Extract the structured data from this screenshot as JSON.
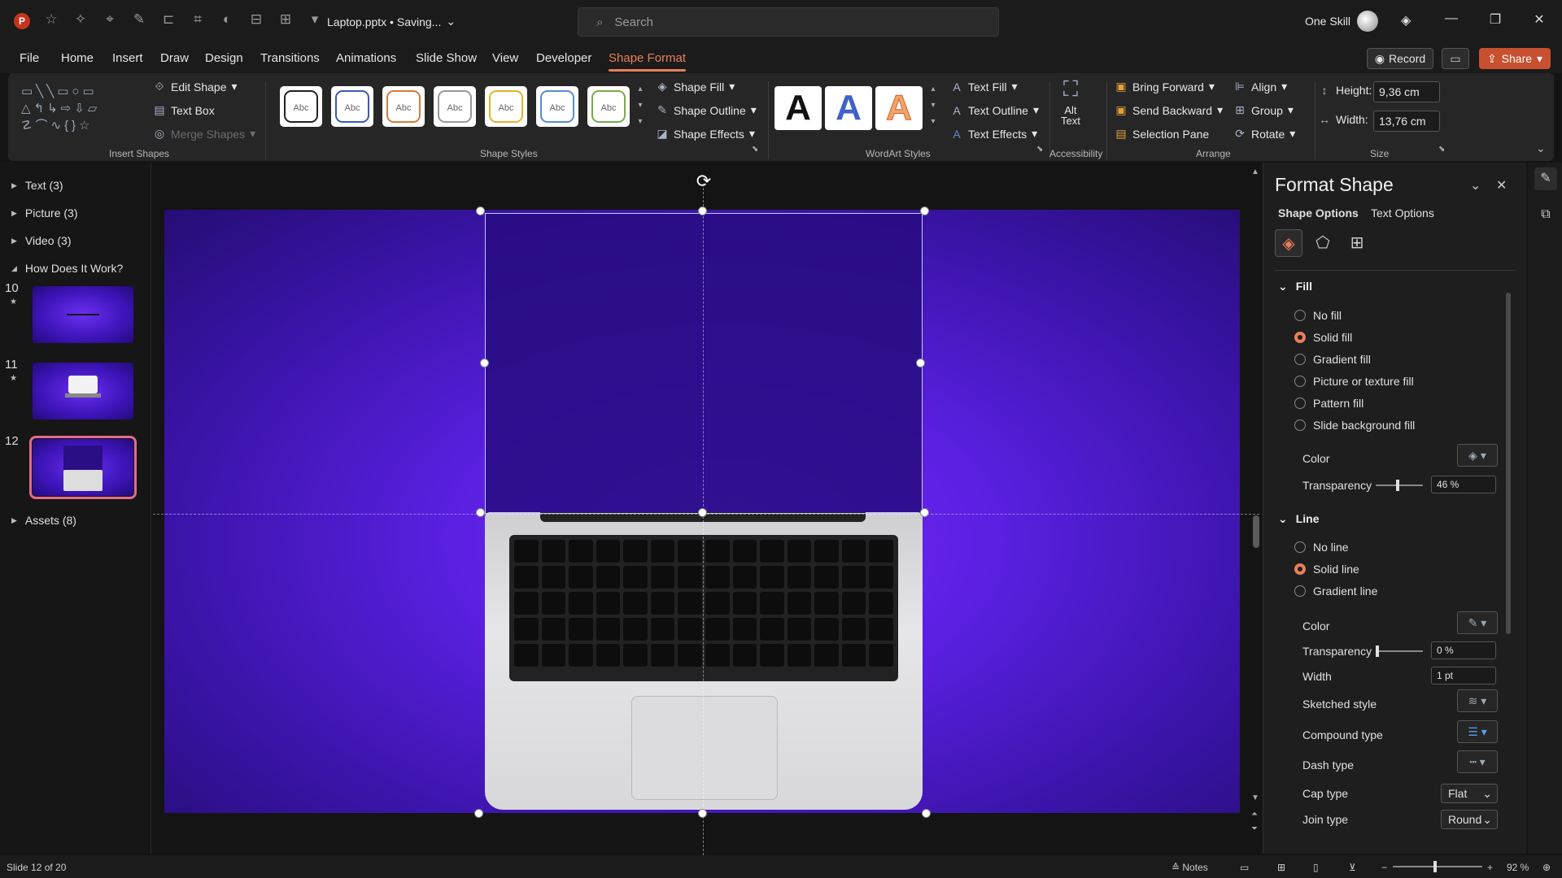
{
  "titlebar": {
    "doc_title": "Laptop.pptx • Saving...",
    "search_placeholder": "Search",
    "user": "One Skill"
  },
  "menu": [
    "File",
    "Home",
    "Insert",
    "Draw",
    "Design",
    "Transitions",
    "Animations",
    "Slide Show",
    "View",
    "Developer",
    "Shape Format"
  ],
  "menu_active": "Shape Format",
  "header_buttons": {
    "record": "Record",
    "share": "Share"
  },
  "ribbon": {
    "insert_shapes": {
      "label": "Insert Shapes",
      "edit_shape": "Edit Shape",
      "text_box": "Text Box",
      "merge_shapes": "Merge Shapes"
    },
    "shape_styles": {
      "label": "Shape Styles",
      "swatch_text": "Abc",
      "shape_fill": "Shape Fill",
      "shape_outline": "Shape Outline",
      "shape_effects": "Shape Effects"
    },
    "wordart": {
      "label": "WordArt Styles",
      "letter": "A",
      "text_fill": "Text Fill",
      "text_outline": "Text Outline",
      "text_effects": "Text Effects"
    },
    "accessibility": {
      "label": "Accessibility",
      "alt_text_1": "Alt",
      "alt_text_2": "Text"
    },
    "arrange": {
      "label": "Arrange",
      "bring_forward": "Bring Forward",
      "send_backward": "Send Backward",
      "selection_pane": "Selection Pane",
      "align": "Align",
      "group": "Group",
      "rotate": "Rotate"
    },
    "size": {
      "label": "Size",
      "height_label": "Height:",
      "height_value": "9,36 cm",
      "width_label": "Width:",
      "width_value": "13,76 cm"
    }
  },
  "slides_pane": {
    "sections": [
      {
        "label": "Text (3)"
      },
      {
        "label": "Picture (3)"
      },
      {
        "label": "Video (3)"
      },
      {
        "label": "How Does It Work?"
      },
      {
        "label": "Assets (8)"
      }
    ],
    "slides": [
      {
        "num": "10"
      },
      {
        "num": "11"
      },
      {
        "num": "12"
      }
    ]
  },
  "format_pane": {
    "title": "Format Shape",
    "tabs": [
      "Shape Options",
      "Text Options"
    ],
    "fill": {
      "heading": "Fill",
      "options": [
        "No fill",
        "Solid fill",
        "Gradient fill",
        "Picture or texture fill",
        "Pattern fill",
        "Slide background fill"
      ],
      "selected": "Solid fill",
      "color_label": "Color",
      "transparency_label": "Transparency",
      "transparency_value": "46 %",
      "transparency_fraction": 0.46
    },
    "line": {
      "heading": "Line",
      "options": [
        "No line",
        "Solid line",
        "Gradient line"
      ],
      "selected": "Solid line",
      "color_label": "Color",
      "transparency_label": "Transparency",
      "transparency_value": "0 %",
      "transparency_fraction": 0,
      "width_label": "Width",
      "width_value": "1 pt",
      "sketched_label": "Sketched style",
      "compound_label": "Compound type",
      "dash_label": "Dash type",
      "cap_label": "Cap type",
      "cap_value": "Flat",
      "join_label": "Join type",
      "join_value": "Round"
    }
  },
  "statusbar": {
    "slide_info": "Slide 12 of 20",
    "notes": "Notes",
    "zoom": "92 %"
  },
  "colors": {
    "accent": "#e87f5a",
    "share_bg": "#c7502f",
    "slide_purple": "#5a1fe0"
  }
}
